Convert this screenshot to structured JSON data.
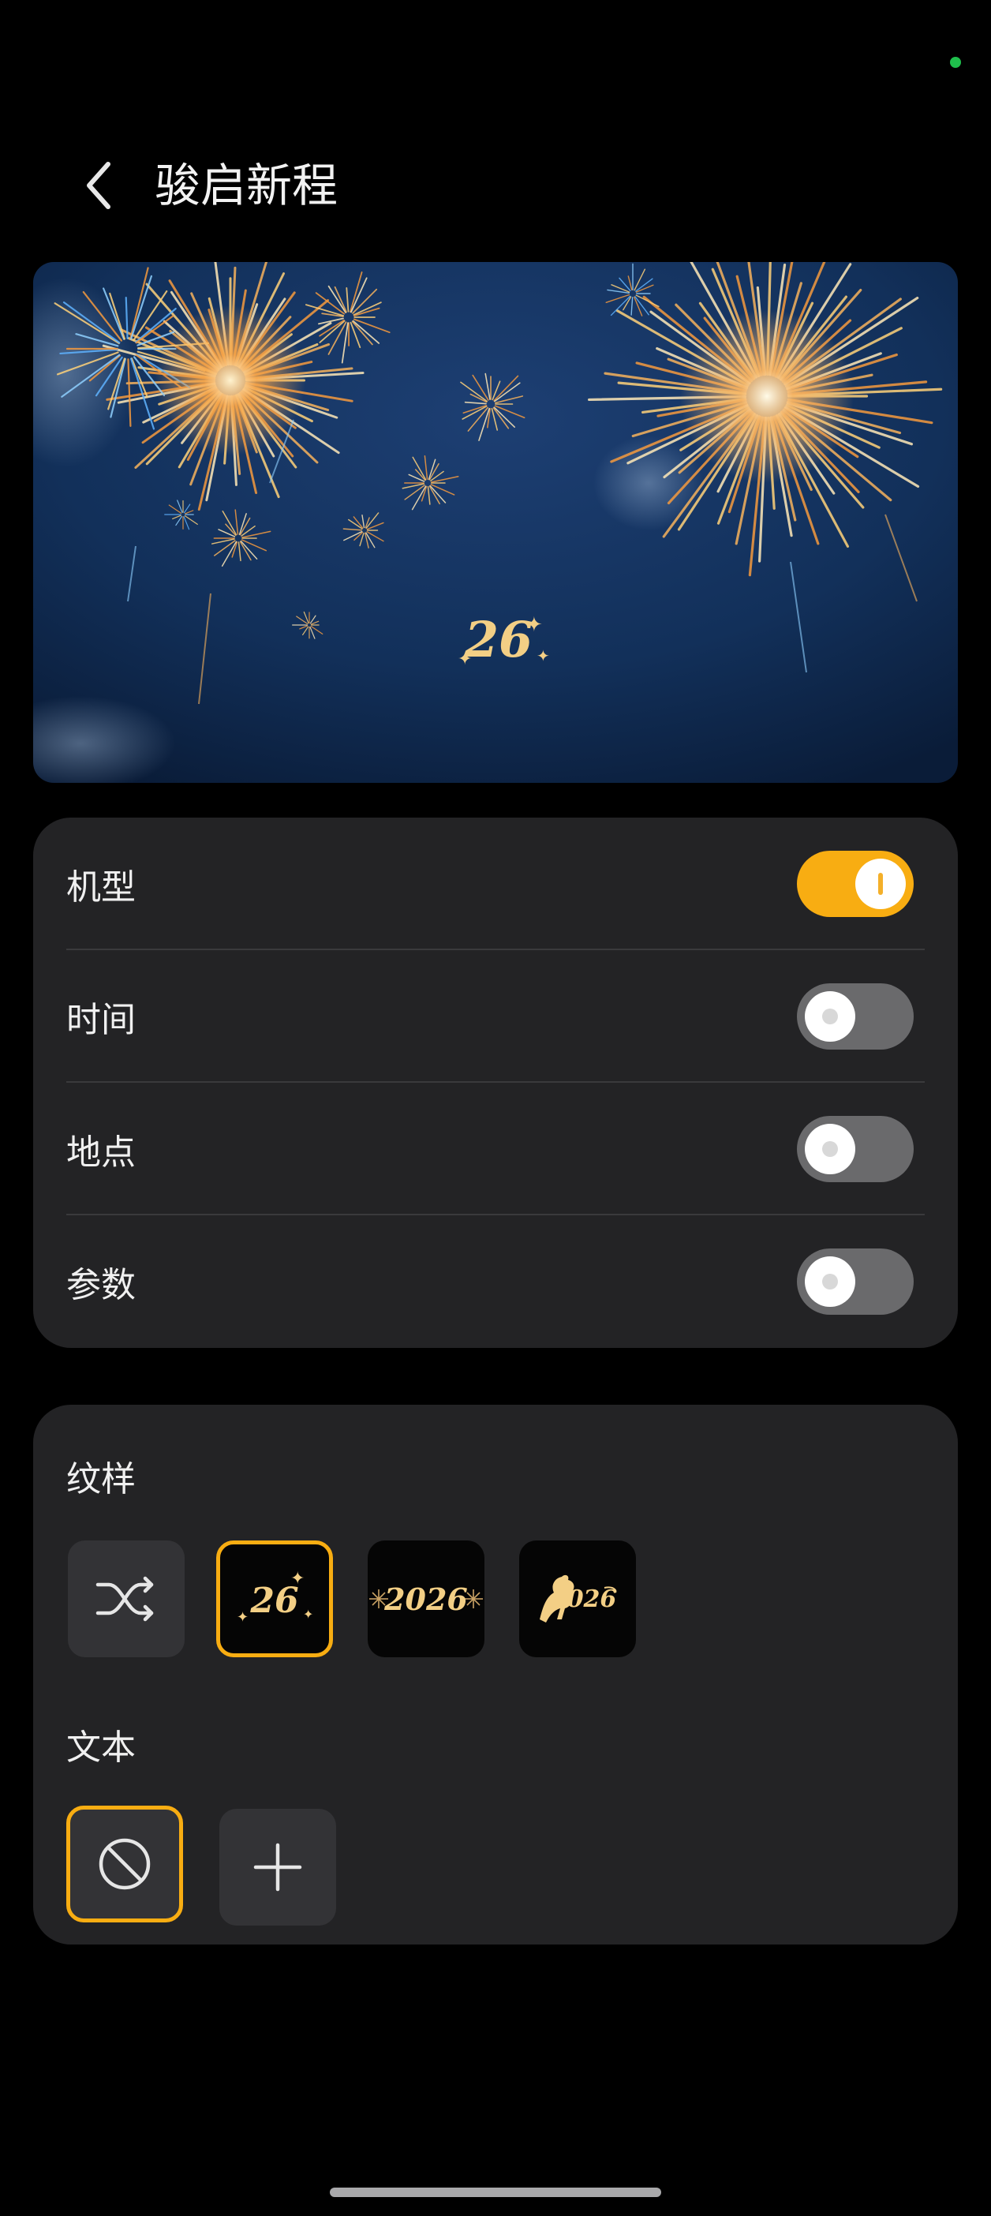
{
  "header": {
    "title": "骏启新程",
    "back_icon": "chevron-left-icon"
  },
  "preview": {
    "description_mark": "2026 horse calligraphy mark"
  },
  "options": [
    {
      "label": "机型",
      "enabled": true
    },
    {
      "label": "时间",
      "enabled": false
    },
    {
      "label": "地点",
      "enabled": false
    },
    {
      "label": "参数",
      "enabled": false
    }
  ],
  "pattern": {
    "label": "纹样",
    "selected_index": 1,
    "items": [
      {
        "icon": "shuffle-icon"
      },
      {
        "icon": "calligraphy-26-sparkle-icon",
        "text": "26"
      },
      {
        "icon": "fireworks-2026-icon",
        "text": "2026"
      },
      {
        "icon": "horse-2026-icon",
        "text": "026"
      }
    ]
  },
  "text": {
    "label": "文本",
    "selected_index": 0,
    "items": [
      {
        "icon": "none-circle-slash-icon"
      },
      {
        "icon": "plus-icon"
      }
    ]
  },
  "colors": {
    "accent": "#f8ad12",
    "card": "#232325",
    "gold": "#f3cf85"
  }
}
